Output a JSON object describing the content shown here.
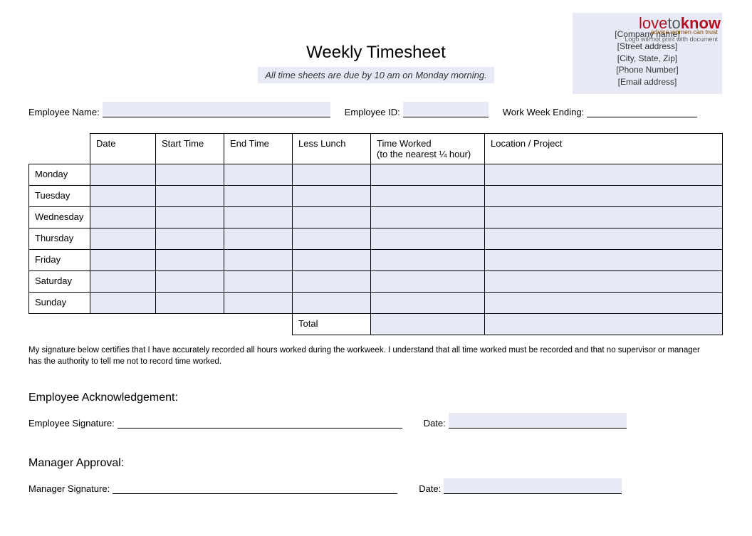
{
  "title": "Weekly Timesheet",
  "subtitle": "All time sheets are due by 10 am on Monday morning.",
  "logo": {
    "brand_love": "love",
    "brand_to": "to",
    "brand_know": "know",
    "tagline": "advice women can trust",
    "note": "Logo will not print with document"
  },
  "company": {
    "name": "[Company name]",
    "street": "[Street address]",
    "city": "[City, State, Zip]",
    "phone": "[Phone Number]",
    "email": "[Email address]"
  },
  "info": {
    "employee_name_label": "Employee Name:",
    "employee_id_label": "Employee ID:",
    "work_week_label": "Work Week Ending:"
  },
  "headers": {
    "date": "Date",
    "start": "Start Time",
    "end": "End Time",
    "lunch": "Less Lunch",
    "worked": "Time Worked\n(to the nearest ¼ hour)",
    "location": "Location / Project"
  },
  "days": [
    "Monday",
    "Tuesday",
    "Wednesday",
    "Thursday",
    "Friday",
    "Saturday",
    "Sunday"
  ],
  "total_label": "Total",
  "cert_text": "My signature below certifies that I have accurately recorded all hours worked during the workweek. I understand that all time worked must be recorded and that no supervisor or manager has the authority to tell me not to record time worked.",
  "ack": {
    "heading": "Employee Acknowledgement:",
    "sig_label": "Employee Signature:",
    "date_label": "Date:"
  },
  "mgr": {
    "heading": "Manager Approval:",
    "sig_label": "Manager Signature:",
    "date_label": "Date:"
  }
}
